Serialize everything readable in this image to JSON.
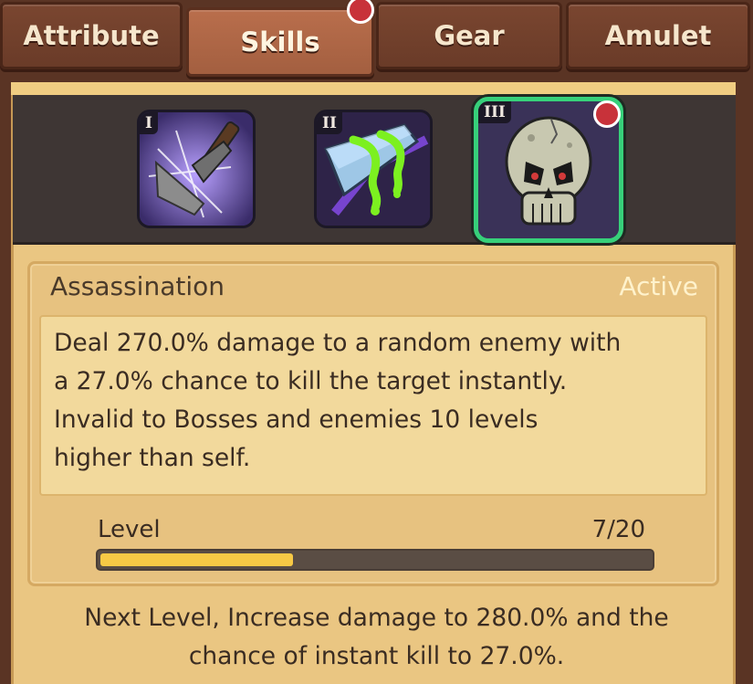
{
  "tabs": [
    {
      "label": "Attribute",
      "active": false,
      "badge": false
    },
    {
      "label": "Skills",
      "active": true,
      "badge": true
    },
    {
      "label": "Gear",
      "active": false,
      "badge": false
    },
    {
      "label": "Amulet",
      "active": false,
      "badge": false
    }
  ],
  "skills": [
    {
      "numeral": "I",
      "icon": "crossed-blades-icon",
      "selected": false,
      "badge": false
    },
    {
      "numeral": "II",
      "icon": "poison-blade-icon",
      "selected": false,
      "badge": false
    },
    {
      "numeral": "III",
      "icon": "skull-icon",
      "selected": true,
      "badge": true
    }
  ],
  "detail": {
    "name": "Assassination",
    "type": "Active",
    "description_lines": [
      "Deal 270.0% damage to a random enemy with",
      "a 27.0% chance to kill the target instantly.",
      "Invalid to Bosses and enemies 10 levels",
      "higher than self."
    ],
    "level_label": "Level",
    "level_value": "7/20",
    "level_progress": 0.35
  },
  "next_level": [
    "Next Level, Increase damage to 280.0% and the",
    "chance of instant kill to 27.0%."
  ],
  "colors": {
    "selected_border": "#37d07a",
    "badge": "#c8323a",
    "progress_fill": "#f7c945"
  }
}
